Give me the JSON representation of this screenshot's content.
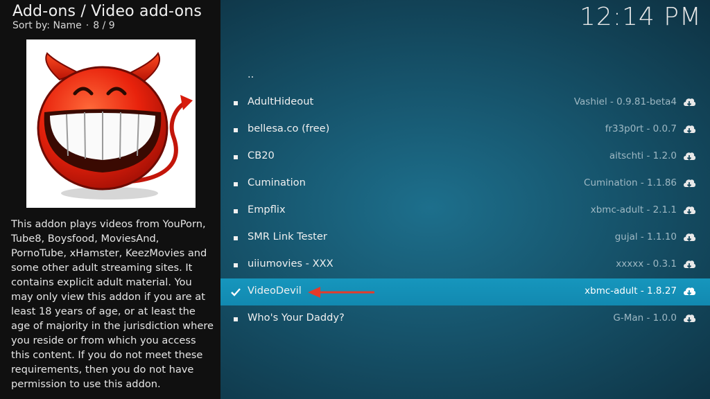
{
  "header": {
    "title": "Add-ons / Video add-ons",
    "sort_label": "Sort by: Name",
    "position": "8 / 9"
  },
  "clock": "12:14 PM",
  "addon_description": "This addon plays videos from YouPorn, Tube8, Boysfood, MoviesAnd, PornoTube, xHamster, KeezMovies and some other adult streaming sites. It contains explicit adult material. You may only view this addon if you are at least 18 years of age, or at least the age of majority in the jurisdiction where you reside or from which you access this content. If you do not meet these requirements, then you do not have permission to use this addon.",
  "icons": {
    "thumbnail": "smiling-devil-icon",
    "row_marker": "bullet-square-icon",
    "selected_marker": "checkmark-icon",
    "install": "cloud-download-icon",
    "annotation": "red-arrow-left-icon"
  },
  "colors": {
    "selected_row": "#1696bd",
    "annotation_arrow": "#e53a2a",
    "devil_red": "#e8220c"
  },
  "list": {
    "parent": "..",
    "items": [
      {
        "name": "AdultHideout",
        "meta": "Vashiel - 0.9.81-beta4"
      },
      {
        "name": "bellesa.co (free)",
        "meta": "fr33p0rt - 0.0.7"
      },
      {
        "name": "CB20",
        "meta": "aitschti - 1.2.0"
      },
      {
        "name": "Cumination",
        "meta": "Cumination - 1.1.86"
      },
      {
        "name": "Empflix",
        "meta": "xbmc-adult - 2.1.1"
      },
      {
        "name": "SMR Link Tester",
        "meta": "gujal - 1.1.10"
      },
      {
        "name": "uiiumovies - XXX",
        "meta": "xxxxx - 0.3.1"
      },
      {
        "name": "VideoDevil",
        "meta": "xbmc-adult - 1.8.27"
      },
      {
        "name": "Who's Your Daddy?",
        "meta": "G-Man - 1.0.0"
      }
    ]
  }
}
